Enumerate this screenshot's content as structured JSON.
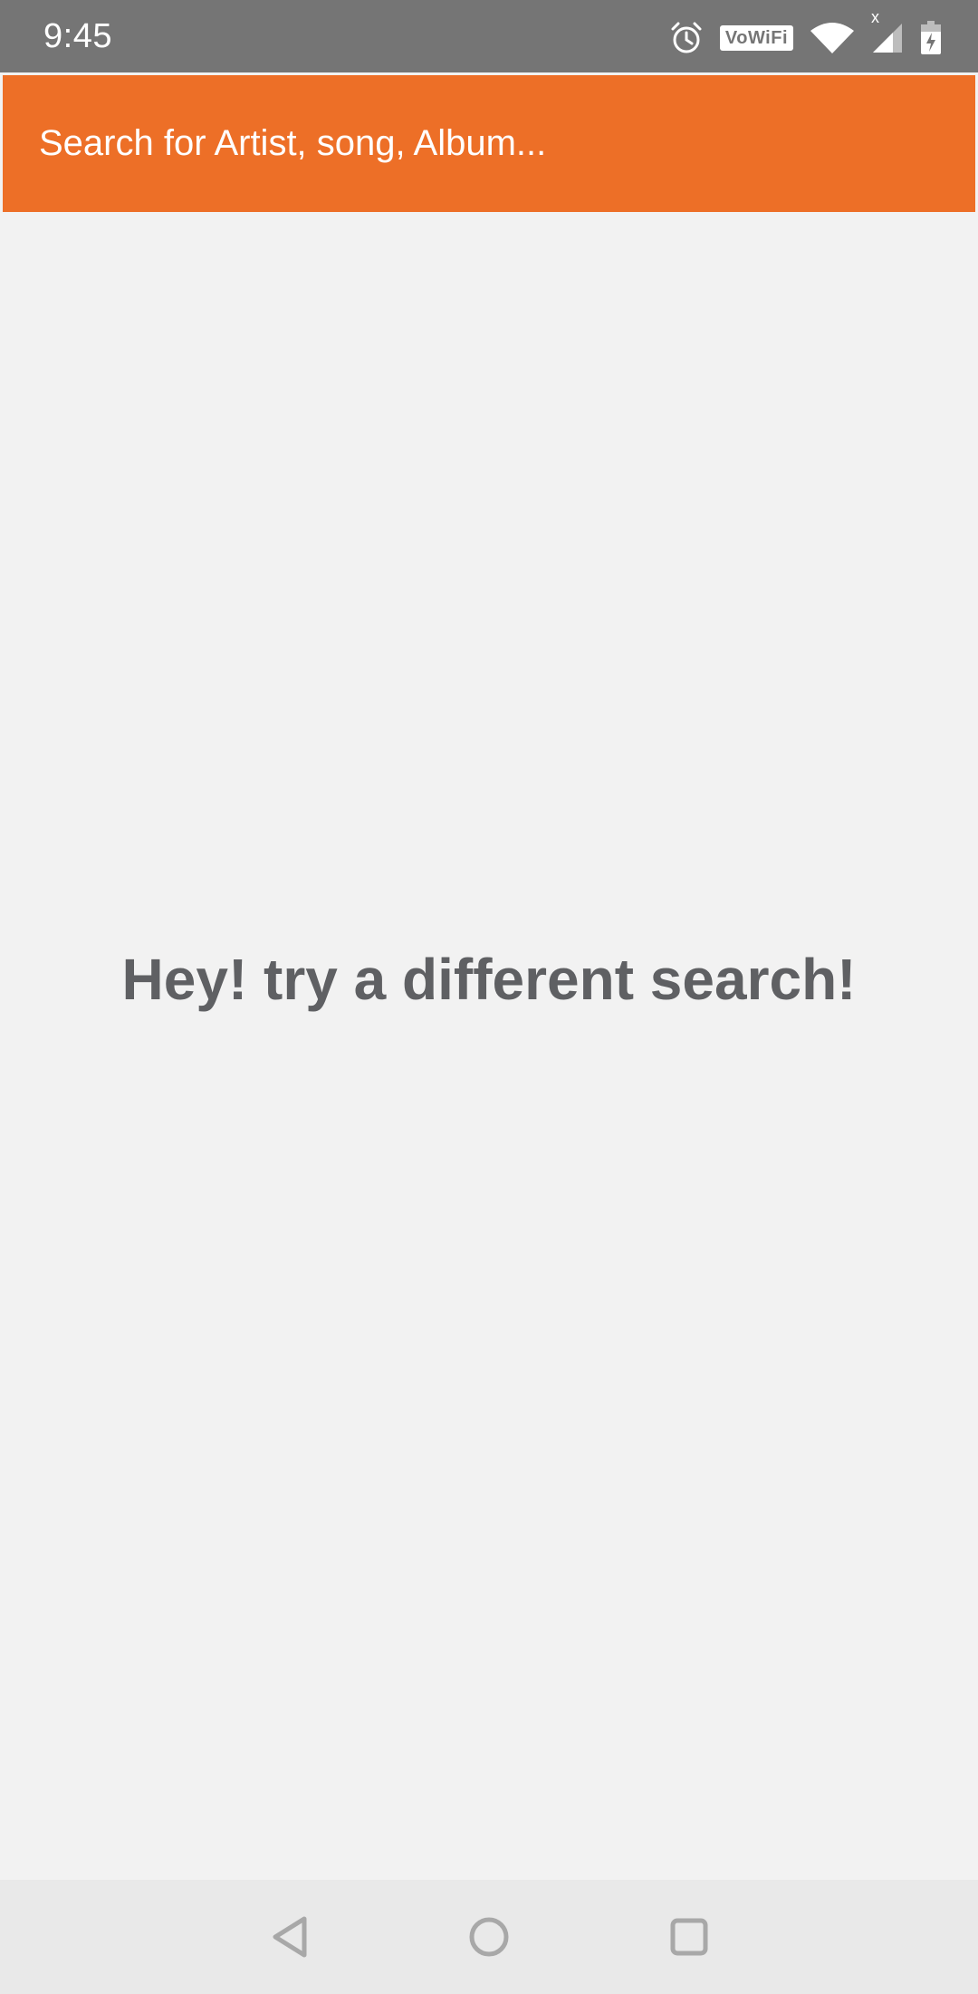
{
  "status_bar": {
    "time": "9:45",
    "icons": [
      "alarm-icon",
      "vowifi-icon",
      "wifi-icon",
      "signal-icon",
      "battery-charging-icon"
    ],
    "vowifi_label": "VoWiFi",
    "signal_badge": "x",
    "background_color": "#757575"
  },
  "search": {
    "placeholder": "Search for Artist, song, Album...",
    "value": "",
    "background_color": "#ed6f27"
  },
  "empty_state": {
    "message": "Hey! try a different search!",
    "text_color": "#5f6063"
  },
  "nav_bar": {
    "buttons": [
      {
        "name": "back",
        "icon": "back-triangle-icon"
      },
      {
        "name": "home",
        "icon": "home-circle-icon"
      },
      {
        "name": "recents",
        "icon": "recents-square-icon"
      }
    ]
  }
}
